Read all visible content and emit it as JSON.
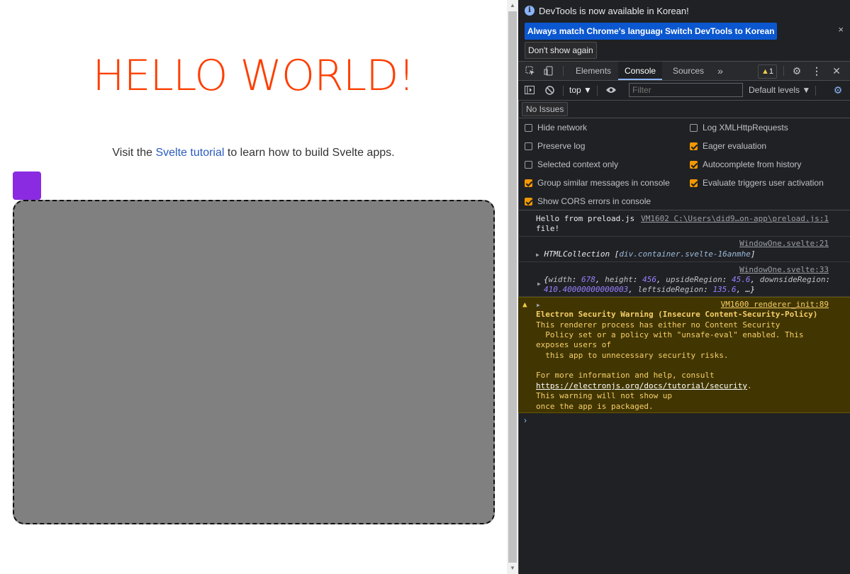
{
  "app": {
    "heading": "HELLO WORLD!",
    "visit_prefix": "Visit the ",
    "visit_link": "Svelte tutorial",
    "visit_suffix": " to learn how to build Svelte apps."
  },
  "devtools": {
    "infobar": {
      "message": "DevTools is now available in Korean!",
      "btn_match": "Always match Chrome's language",
      "btn_switch": "Switch DevTools to Korean",
      "btn_dont_show": "Don't show again",
      "close": "×"
    },
    "tabs": {
      "elements": "Elements",
      "console": "Console",
      "sources": "Sources",
      "more": "»",
      "warning_count": "1"
    },
    "console_bar": {
      "context": "top ▼",
      "filter_placeholder": "Filter",
      "levels": "Default levels ▼"
    },
    "issues": "No Issues",
    "settings": {
      "hide_network": "Hide network",
      "preserve_log": "Preserve log",
      "selected_context": "Selected context only",
      "group_similar": "Group similar messages in console",
      "show_cors": "Show CORS errors in console",
      "log_xhr": "Log XMLHttpRequests",
      "eager_eval": "Eager evaluation",
      "autocomplete": "Autocomplete from history",
      "evaluate_triggers": "Evaluate triggers user activation"
    },
    "messages": {
      "m1_text": "Hello from preload.js",
      "m1_text2": "file!",
      "m1_src": "VM1602 C:\\Users\\did9…on-app\\preload.js:1",
      "m2_src": "WindowOne.svelte:21",
      "m2_name": "HTMLCollection",
      "m2_value": "div.container.svelte-16anmhe",
      "m3_src": "WindowOne.svelte:33",
      "m3_line1_k1": "width",
      "m3_line1_v1": "678",
      "m3_line1_k2": "height",
      "m3_line1_v2": "456",
      "m3_line1_k3": "upsideRegion",
      "m3_line1_v3": "45.6",
      "m3_line1_k4": "downsideRegion",
      "m3_line2_v4": "410.40000000000003",
      "m3_line2_k5": "leftsideRegion",
      "m3_line2_v5": "135.6"
    },
    "warning": {
      "src": "VM1600 renderer_init:89",
      "title": "Electron Security Warning (Insecure Content-Security-Policy)",
      "l1": "This renderer process has either no Content Security",
      "l2": "  Policy set or a policy with \"unsafe-eval\" enabled. This",
      "l3": "exposes users of",
      "l4": "  this app to unnecessary security risks.",
      "l5": "For more information and help, consult",
      "link": "https://electronjs.org/docs/tutorial/security",
      "l6": "This warning will not show up",
      "l7": "once the app is packaged."
    },
    "prompt": "›"
  },
  "colors": {
    "heading": "#ff3e00",
    "link": "#2a5bbf",
    "purple_box": "#8a2be2",
    "container": "#808080",
    "devtools_bg": "#202124",
    "warning_bg": "#413602",
    "warning_text": "#f7ce6b",
    "primary_button": "#0b57d0"
  }
}
